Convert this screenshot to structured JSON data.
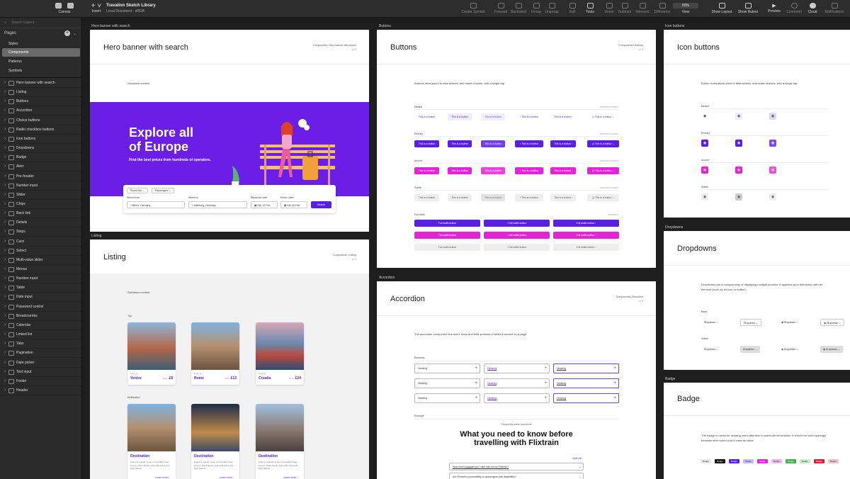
{
  "toolbar": {
    "canvas": "Canvas",
    "insert": "Insert",
    "doc_title": "Travalion Sketch Library",
    "doc_sub": "Local Document · sRGB",
    "create_symbol": "Create Symbol",
    "forward": "Forward",
    "backward": "Backward",
    "group": "Group",
    "ungroup": "Ungroup",
    "edit": "Edit",
    "tools": "Tools",
    "union": "Union",
    "subtract": "Subtract",
    "intersect": "Intersect",
    "difference": "Difference",
    "zoom": "50%",
    "view": "View",
    "show_layout": "Show Layout",
    "show_rulers": "Show Rulers",
    "preview": "Preview",
    "comment": "Comment",
    "cloud": "Cloud",
    "notifications": "Notifications"
  },
  "sidebar": {
    "search_placeholder": "Search Layers",
    "pages_label": "Pages",
    "pages": [
      "Styles",
      "Components",
      "Patterns",
      "Symbols"
    ],
    "layers": [
      "Hero banner with search",
      "Listing",
      "Buttons",
      "Accordion",
      "Choice buttons",
      "Radio checkbox buttons",
      "Icon buttons",
      "Dropdowns",
      "Badge",
      "Alert",
      "Pre-header",
      "Number input",
      "Slider",
      "Chips",
      "Back link",
      "Details",
      "Steps",
      "Card",
      "Select",
      "Multi-value slider",
      "Menus",
      "Number input",
      "Table",
      "Date input",
      "Password control",
      "Breadcrumbs",
      "Calendar",
      "Linked list",
      "Tabs",
      "Pagination",
      "Date picker",
      "Text input",
      "Footer",
      "Header"
    ]
  },
  "hero": {
    "label": "Hero banner with search",
    "title": "Hero banner with search",
    "crumb": "Components / Hero banner with search",
    "sub": "v0.0",
    "guidance": "Guidance content.",
    "headline1": "Explore all",
    "headline2": "of Europe",
    "tagline": "Find the best prices from hundreds of operators.",
    "round_trip": "Round trip",
    "passengers": "Passengers",
    "where_from": "Where from",
    "from_val": "Berlin, Germany",
    "where_to": "Where to",
    "to_val": "Hamburg, Germany",
    "departure": "Departure date",
    "dep_val": "Sat, 22 Feb",
    "return": "Return date",
    "ret_val": "Sat, 29 Feb",
    "search": "Search"
  },
  "listing": {
    "label": "Listing",
    "title": "Listing",
    "crumb": "Components / Listing",
    "sub": "v0.0",
    "guidance": "Guidance content.",
    "trip": "Trip",
    "destination": "Destination",
    "from_label": "From",
    "from_small": "From to",
    "trips": [
      {
        "city": "Venice",
        "price": "£8"
      },
      {
        "city": "Rome",
        "price": "£12"
      },
      {
        "city": "Croatia",
        "price": "£24"
      }
    ],
    "dest_title": "Destination",
    "dest_desc": "France's capital, home to the Eiffel Tower, Louvre, Notre-Dame, side walk cafes and high fashion.",
    "learn_more": "Learn more"
  },
  "buttons": {
    "label": "Buttons",
    "title": "Buttons",
    "crumb": "Components / Buttons",
    "sub": "v0.0",
    "desc": "Buttons allow users to take actions, and make choices, with a single tap.",
    "rows": [
      "Default",
      "Primary",
      "Accent",
      "Subtle"
    ],
    "interactive": "Interactive states",
    "btn": "This is a button",
    "full_width": "Full width",
    "variations": "Variations",
    "full_btn": "Full width button"
  },
  "accordion": {
    "label": "Accordion",
    "title": "Accordion",
    "crumb": "Components / Accordion",
    "sub": "v0.0",
    "desc": "The accordion component lets users show and hide sections of related content on a page.",
    "elements": "Elements",
    "heading": "Heading",
    "example": "Example",
    "faq": "Frequently asked questions",
    "headline1": "What you need to know before",
    "headline2": "travelling with Flixtrain",
    "open_all": "Open all",
    "q1": "How much luggage can I take with me on Flixtrain?",
    "q2": "Are Flixtrain's accessibility to passengers with disabilities?"
  },
  "iconbuttons": {
    "label": "Icon buttons",
    "title": "Icon buttons",
    "desc": "Button icons allow users to take actions, and make choices, with a single tap.",
    "rows": [
      "Default",
      "Primary",
      "Accent",
      "Subtle"
    ]
  },
  "dropdowns": {
    "label": "Dropdowns",
    "title": "Dropdowns",
    "desc": "Dropdowns are a compact way of displaying multiple choices. It appears upon interaction with an element (such as an icon or button).",
    "basic": "Basic",
    "subtle": "Subtle",
    "dd": "Dropdown"
  },
  "badge": {
    "label": "Badge",
    "title": "Badge",
    "desc": "The badge is useful for drawing users attention to particular information. It should be used sparingly because when used a lot it loses its value.",
    "badge": "Badge",
    "colors": [
      "#e8e8e8",
      "#111111",
      "#5a1ee6",
      "#c9b8f7",
      "#e224d6",
      "#f3b7ef",
      "#3cb54a",
      "#c6ecc9",
      "#e0203a",
      "#f7c0c6"
    ]
  },
  "colors": {
    "purple": "#5a1ee6",
    "magenta": "#e224d6",
    "selected_page": "#6a6a6a"
  }
}
